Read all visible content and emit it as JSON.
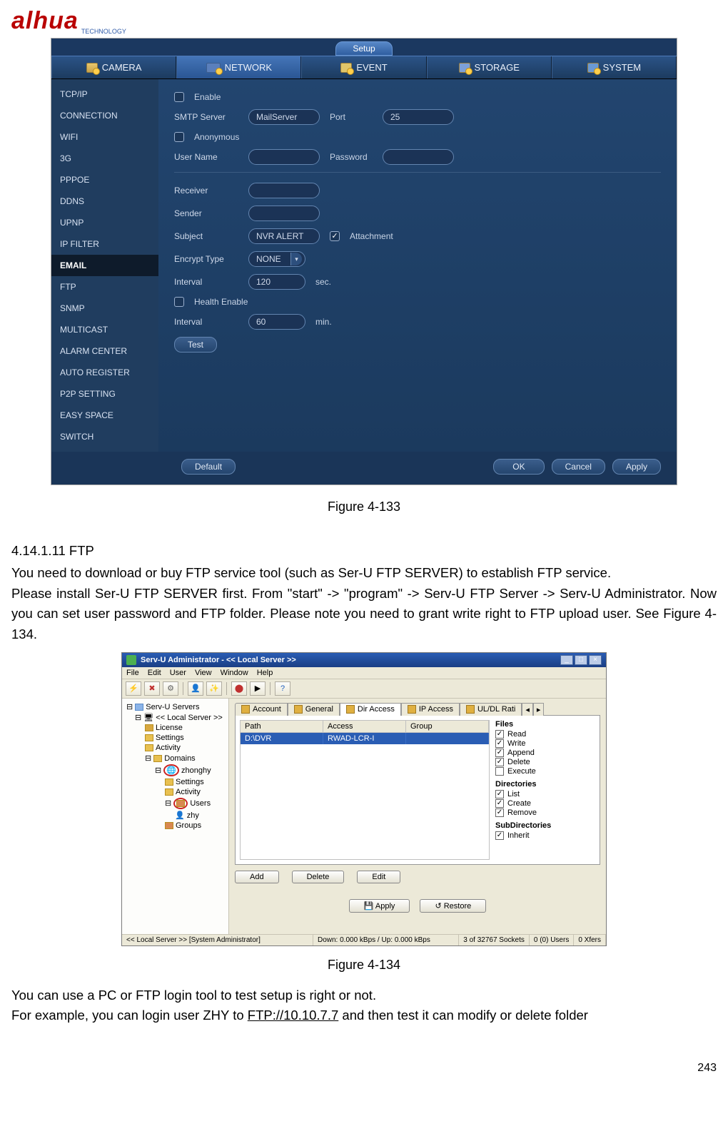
{
  "logo": {
    "brand": "alhua",
    "sub": "TECHNOLOGY"
  },
  "fig1": {
    "setup_tab": "Setup",
    "tabs": {
      "camera": "CAMERA",
      "network": "NETWORK",
      "event": "EVENT",
      "storage": "STORAGE",
      "system": "SYSTEM"
    },
    "sidebar": [
      "TCP/IP",
      "CONNECTION",
      "WIFI",
      "3G",
      "PPPOE",
      "DDNS",
      "UPNP",
      "IP FILTER",
      "EMAIL",
      "FTP",
      "SNMP",
      "MULTICAST",
      "ALARM CENTER",
      "AUTO REGISTER",
      "P2P SETTING",
      "EASY SPACE",
      "SWITCH"
    ],
    "sidebar_selected": "EMAIL",
    "fields": {
      "enable": "Enable",
      "smtp_server_lbl": "SMTP Server",
      "smtp_server_val": "MailServer",
      "port_lbl": "Port",
      "port_val": "25",
      "anonymous": "Anonymous",
      "username_lbl": "User Name",
      "username_val": "",
      "password_lbl": "Password",
      "password_val": "",
      "receiver_lbl": "Receiver",
      "receiver_val": "",
      "sender_lbl": "Sender",
      "sender_val": "",
      "subject_lbl": "Subject",
      "subject_val": "NVR ALERT",
      "attachment_lbl": "Attachment",
      "encrypt_lbl": "Encrypt Type",
      "encrypt_val": "NONE",
      "interval_lbl": "Interval",
      "interval_val": "120",
      "interval_unit": "sec.",
      "health_enable": "Health Enable",
      "interval2_lbl": "Interval",
      "interval2_val": "60",
      "interval2_unit": "min.",
      "test_btn": "Test"
    },
    "bottom": {
      "default": "Default",
      "ok": "OK",
      "cancel": "Cancel",
      "apply": "Apply"
    }
  },
  "caption1": "Figure 4-133",
  "section": {
    "heading": "4.14.1.11    FTP",
    "p1": "You need to download or buy FTP service tool (such as Ser-U FTP SERVER) to establish FTP service.",
    "p2a": "Please install Ser-U FTP SERVER first. From \"start\" -> \"program\" -> Serv-U FTP Server -> Serv-U Administrator. Now you can set user password and FTP folder. Please note you need to grant write right to FTP upload user. See Figure 4-134."
  },
  "fig2": {
    "title": "Serv-U Administrator - << Local Server >>",
    "menu": [
      "File",
      "Edit",
      "User",
      "View",
      "Window",
      "Help"
    ],
    "tree": {
      "root": "Serv-U Servers",
      "local": "<< Local Server >>",
      "license": "License",
      "settings": "Settings",
      "activity": "Activity",
      "domains": "Domains",
      "domain1": "zhonghy",
      "d_settings": "Settings",
      "d_activity": "Activity",
      "users": "Users",
      "user1": "zhy",
      "groups": "Groups"
    },
    "tabs": [
      "Account",
      "General",
      "Dir Access",
      "IP Access",
      "UL/DL Rati"
    ],
    "tab_arrows": {
      "left": "◂",
      "right": "▸"
    },
    "list": {
      "headers": [
        "Path",
        "Access",
        "Group"
      ],
      "row": [
        "D:\\DVR",
        "RWAD-LCR-I",
        ""
      ]
    },
    "perms": {
      "files_head": "Files",
      "files": [
        "Read",
        "Write",
        "Append",
        "Delete",
        "Execute"
      ],
      "files_checked": [
        true,
        true,
        true,
        true,
        false
      ],
      "dirs_head": "Directories",
      "dirs": [
        "List",
        "Create",
        "Remove"
      ],
      "dirs_checked": [
        true,
        true,
        true
      ],
      "sub_head": "SubDirectories",
      "sub": [
        "Inherit"
      ],
      "sub_checked": [
        true
      ]
    },
    "row_btns": {
      "add": "Add",
      "delete": "Delete",
      "edit": "Edit"
    },
    "apply_btns": {
      "apply": "Apply",
      "restore": "Restore"
    },
    "status": {
      "s1": "<< Local Server >>  [System Administrator]",
      "s2": "Down: 0.000 kBps / Up: 0.000 kBps",
      "s3": "3 of 32767 Sockets",
      "s4": "0 (0) Users",
      "s5": "0 Xfers"
    }
  },
  "caption2": "Figure 4-134",
  "tail": {
    "p3": "You can use a PC or FTP login tool to test setup is right or not.",
    "p4a": "For example, you can login user ZHY to ",
    "p4link": "FTP://10.10.7.7",
    "p4b": " and then test it can modify or delete folder"
  },
  "pagenum": "243"
}
